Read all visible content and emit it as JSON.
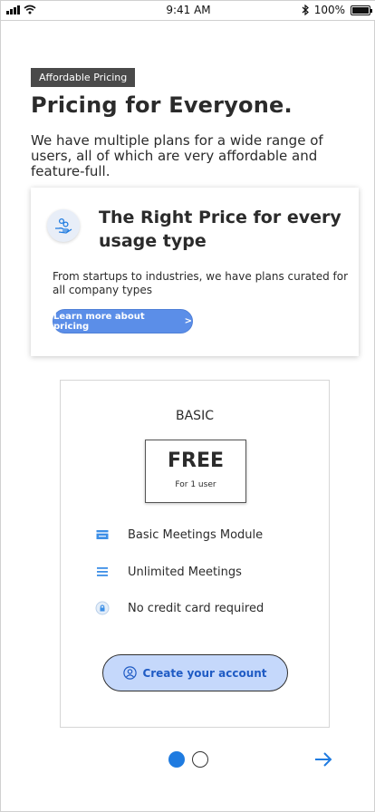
{
  "status_bar": {
    "time": "9:41 AM",
    "battery": "100%",
    "battery_level": 1.0
  },
  "header": {
    "tag": "Affordable Pricing",
    "title": "Pricing for Everyone.",
    "subtitle": "We have multiple plans for a wide range of users, all of which are very affordable and  feature-full."
  },
  "promo": {
    "icon": "hand-coins-icon",
    "title": "The Right Price for every usage type",
    "text": "From startups to industries, we have plans curated for all company types",
    "button_label": "Learn more about pricing",
    "button_chevron": ">"
  },
  "plan": {
    "name": "BASIC",
    "price": "FREE",
    "price_note": "For 1 user",
    "features": [
      {
        "icon": "meetings-module-icon",
        "label": "Basic Meetings Module"
      },
      {
        "icon": "list-icon",
        "label": "Unlimited Meetings"
      },
      {
        "icon": "lock-icon",
        "label": "No credit card required"
      }
    ],
    "cta_label": "Create your account"
  },
  "pager": {
    "current_page": 1,
    "total_pages": 2
  },
  "colors": {
    "accent": "#1f7be0",
    "button_blue": "#5b8ee8",
    "cta_bg": "#c5d8fb",
    "tag_bg": "#4a4a4a"
  }
}
